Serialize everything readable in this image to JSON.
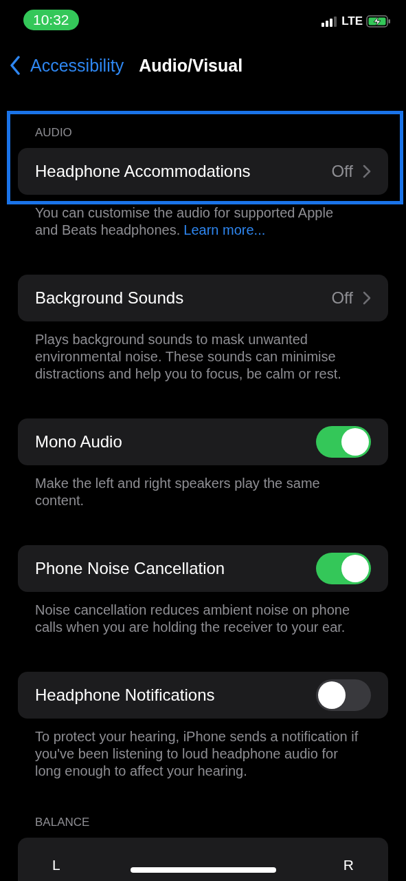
{
  "status_bar": {
    "time": "10:32",
    "network": "LTE"
  },
  "nav": {
    "back": "Accessibility",
    "title": "Audio/Visual"
  },
  "sections": [
    {
      "header": "AUDIO",
      "highlighted": true,
      "row": {
        "kind": "link",
        "label": "Headphone Accommodations",
        "value": "Off"
      },
      "footer": "You can customise the audio for supported Apple and Beats headphones.",
      "footer_link": "Learn more..."
    },
    {
      "row": {
        "kind": "link",
        "label": "Background Sounds",
        "value": "Off"
      },
      "footer": "Plays background sounds to mask unwanted environmental noise. These sounds can minimise distractions and help you to focus, be calm or rest."
    },
    {
      "row": {
        "kind": "toggle",
        "label": "Mono Audio",
        "on": true
      },
      "footer": "Make the left and right speakers play the same content."
    },
    {
      "row": {
        "kind": "toggle",
        "label": "Phone Noise Cancellation",
        "on": true
      },
      "footer": "Noise cancellation reduces ambient noise on phone calls when you are holding the receiver to your ear."
    },
    {
      "row": {
        "kind": "toggle",
        "label": "Headphone Notifications",
        "on": false
      },
      "footer": "To protect your hearing, iPhone sends a notification if you've been listening to loud headphone audio for long enough to affect your hearing."
    }
  ],
  "balance": {
    "header": "BALANCE",
    "left": "L",
    "right": "R"
  }
}
